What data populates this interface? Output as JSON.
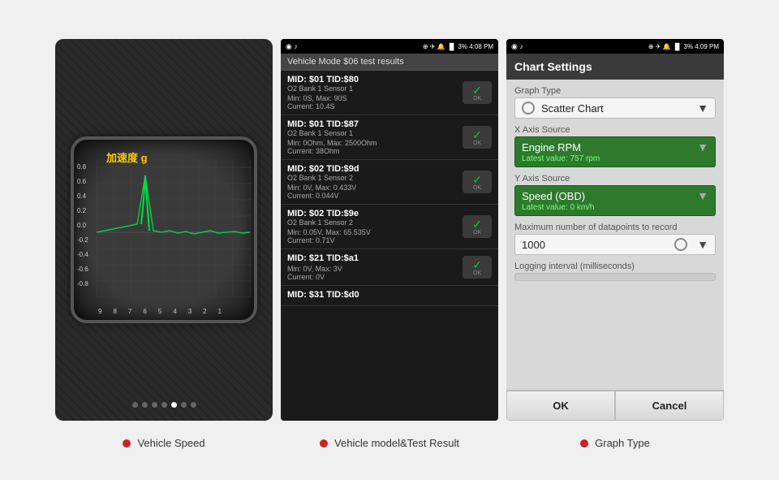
{
  "screens": {
    "screen1": {
      "chart_label": "加速度 g",
      "y_labels": [
        "0.8",
        "0.6",
        "0.4",
        "0.2",
        "0.0",
        "-0.2",
        "-0.4",
        "-0.6",
        "-0.8"
      ],
      "x_labels": [
        "9",
        "8",
        "7",
        "6",
        "5",
        "4",
        "3",
        "2",
        "1"
      ],
      "dots": [
        false,
        false,
        false,
        false,
        true,
        false,
        false
      ]
    },
    "screen2": {
      "status_bar_left": "◉ 🎵",
      "status_bar_right": "🔵 ✈ 🔔 📶 3% 4:08 PM",
      "header": "Vehicle Mode $06 test results",
      "items": [
        {
          "mid": "MID: $01 TID:$80",
          "sensor": "O2 Bank 1 Sensor 1",
          "values": "Min: 0S, Max: 90S\nCurrent: 10.4S",
          "ok": true
        },
        {
          "mid": "MID: $01 TID:$87",
          "sensor": "O2 Bank 1 Sensor 1",
          "values": "Min: 0Ohm, Max: 2500Ohm\nCurrent: 38Ohm",
          "ok": true
        },
        {
          "mid": "MID: $02 TID:$9d",
          "sensor": "O2 Bank 1 Sensor 2",
          "values": "Min: 0V, Max: 0.433V\nCurrent: 0.044V",
          "ok": true
        },
        {
          "mid": "MID: $02 TID:$9e",
          "sensor": "O2 Bank 1 Sensor 2",
          "values": "Min: 0.05V, Max: 65.535V\nCurrent: 0.71V",
          "ok": true
        },
        {
          "mid": "MID: $21 TID:$a1",
          "sensor": "",
          "values": "Min: 0V, Max: 3V\nCurrent: 0V",
          "ok": true
        },
        {
          "mid": "MID: $31 TID:$d0",
          "sensor": "",
          "values": "",
          "ok": false
        }
      ]
    },
    "screen3": {
      "status_bar_left": "◉ 🎵",
      "status_bar_right": "🔵 ✈ 🔔 📶 3% 4:09 PM",
      "header": "Chart Settings",
      "graph_type_label": "Graph Type",
      "graph_type_value": "Scatter Chart",
      "x_axis_label": "X Axis Source",
      "x_axis_value": "Engine RPM",
      "x_axis_latest": "Latest value: 757 rpm",
      "y_axis_label": "Y Axis Source",
      "y_axis_value": "Speed (OBD)",
      "y_axis_latest": "Latest value: 0 km/h",
      "max_datapoints_label": "Maximum number of datapoints to record",
      "max_datapoints_value": "1000",
      "logging_label": "Logging interval (milliseconds)",
      "ok_btn": "OK",
      "cancel_btn": "Cancel"
    }
  },
  "captions": [
    {
      "text": "Vehicle Speed"
    },
    {
      "text": "Vehicle model&Test Result"
    },
    {
      "text": "Graph Type"
    }
  ]
}
